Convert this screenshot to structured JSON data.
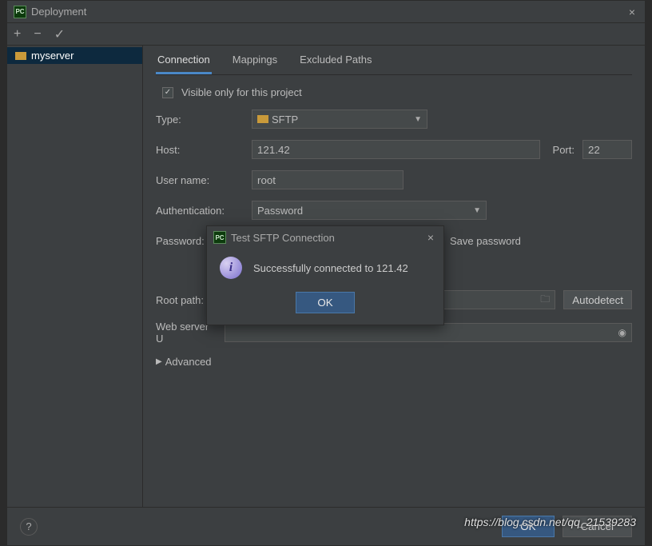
{
  "window": {
    "title": "Deployment",
    "close": "×"
  },
  "toolbar": {
    "add": "+",
    "remove": "−",
    "check": "✓"
  },
  "sidebar": {
    "items": [
      {
        "label": "myserver"
      }
    ]
  },
  "tabs": {
    "connection": "Connection",
    "mappings": "Mappings",
    "excluded": "Excluded Paths"
  },
  "form": {
    "visible_only_label": "Visible only for this project",
    "type_label": "Type:",
    "type_value": "SFTP",
    "host_label": "Host:",
    "host_value": "121.42",
    "port_label": "Port:",
    "port_value": "22",
    "user_label": "User name:",
    "user_value": "root",
    "auth_label": "Authentication:",
    "auth_value": "Password",
    "password_label": "Password:",
    "password_value": "••••••••••••••",
    "save_password_label": "Save password",
    "root_label": "Root path:",
    "autodetect_label": "Autodetect",
    "weburl_label": "Web server U",
    "advanced_label": "Advanced"
  },
  "modal": {
    "title": "Test SFTP Connection",
    "message": "Successfully connected to 121.42",
    "ok": "OK"
  },
  "footer": {
    "help": "?",
    "ok": "OK",
    "cancel": "Cancel"
  },
  "watermark": "https://blog.csdn.net/qq_21539283"
}
